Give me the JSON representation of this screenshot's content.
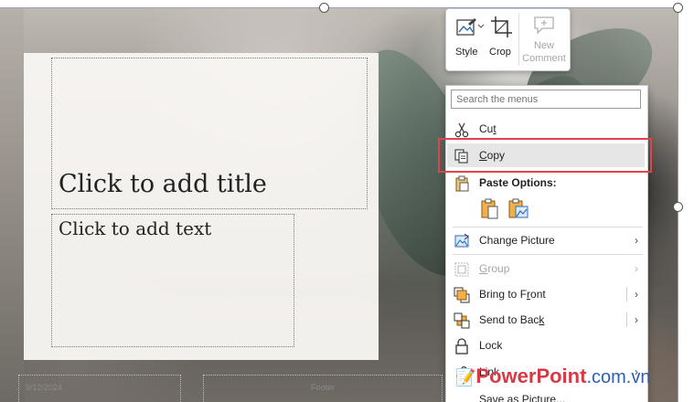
{
  "slide": {
    "title_placeholder": "Click to add title",
    "text_placeholder": "Click to add text",
    "date": "9/12/2024",
    "footer": "Footer"
  },
  "mini_toolbar": {
    "style_label": "Style",
    "crop_label": "Crop",
    "new_comment_line1": "New",
    "new_comment_line2": "Comment"
  },
  "context_menu": {
    "search_placeholder": "Search the menus",
    "cut": {
      "pre": "Cu",
      "key": "t",
      "post": ""
    },
    "copy": {
      "pre": "",
      "key": "C",
      "post": "opy"
    },
    "paste_options": "Paste Options:",
    "change_picture": {
      "pre": "Chan",
      "key": "g",
      "post": "e Picture"
    },
    "group": {
      "pre": "",
      "key": "G",
      "post": "roup"
    },
    "bring_to_front": {
      "pre": "Bring to F",
      "key": "r",
      "post": "ont"
    },
    "send_to_back": {
      "pre": "Send to Bac",
      "key": "k",
      "post": ""
    },
    "lock": "Lock",
    "link": {
      "pre": "",
      "key": "L",
      "post": "ink"
    },
    "save_as_picture": "Save as Picture..."
  },
  "highlight_color": "#e0444a",
  "watermark": {
    "brand": "PowerPoint",
    "domain": ".com.vn"
  }
}
